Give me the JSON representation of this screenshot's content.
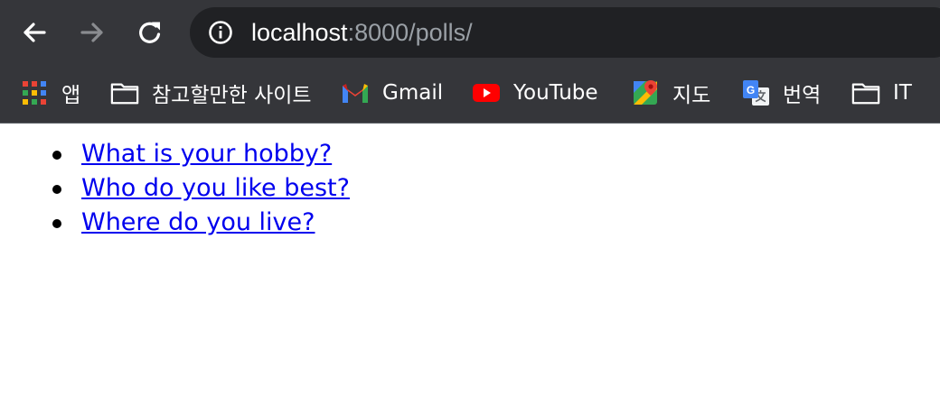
{
  "browser": {
    "address": {
      "host": "localhost",
      "rest": ":8000/polls/"
    },
    "bookmarks": [
      {
        "label": "앱",
        "icon": "apps-grid-icon"
      },
      {
        "label": "참고할만한 사이트",
        "icon": "folder-icon"
      },
      {
        "label": "Gmail",
        "icon": "gmail-icon"
      },
      {
        "label": "YouTube",
        "icon": "youtube-icon"
      },
      {
        "label": "지도",
        "icon": "maps-icon"
      },
      {
        "label": "번역",
        "icon": "translate-icon"
      },
      {
        "label": "IT",
        "icon": "folder-icon"
      }
    ]
  },
  "page": {
    "questions": [
      {
        "text": "What is your hobby?"
      },
      {
        "text": "Who do you like best?"
      },
      {
        "text": "Where do you live?"
      }
    ]
  },
  "colors": {
    "chrome": "#35363a",
    "omnibox": "#202124",
    "link": "#0000ee"
  }
}
